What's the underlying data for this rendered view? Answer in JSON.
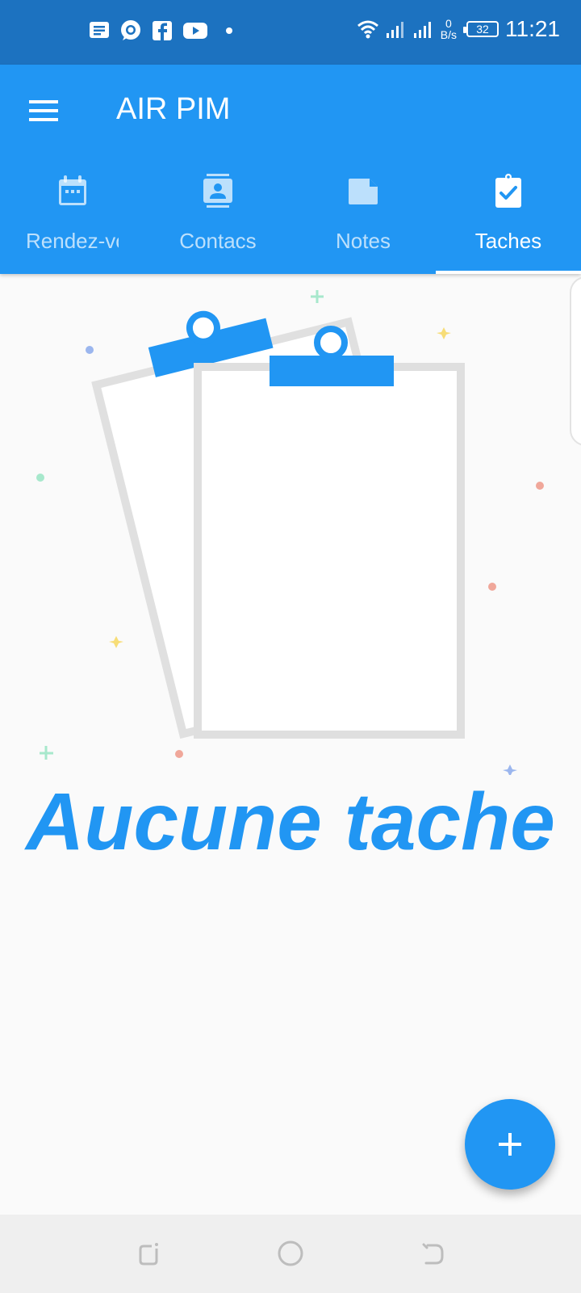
{
  "status_bar": {
    "time": "11:21",
    "net_speed_value": "0",
    "net_speed_unit": "B/s",
    "battery": "32",
    "notification_icons": [
      "message-icon",
      "whatsapp-icon",
      "facebook-icon",
      "youtube-icon",
      "dot-icon"
    ],
    "system_icons": [
      "wifi-icon",
      "signal-icon",
      "signal-icon",
      "battery-icon"
    ]
  },
  "app_bar": {
    "title": "AIR PIM"
  },
  "tabs": [
    {
      "label": "Rendez-vous",
      "icon": "calendar-icon",
      "active": false
    },
    {
      "label": "Contacs",
      "icon": "contact-card-icon",
      "active": false
    },
    {
      "label": "Notes",
      "icon": "note-icon",
      "active": false
    },
    {
      "label": "Taches",
      "icon": "clipboard-check-icon",
      "active": true
    }
  ],
  "empty_state": {
    "message": "Aucune tache",
    "illustration": "clipboard-illustration"
  },
  "fab": {
    "icon": "plus-icon"
  },
  "nav_bar": {
    "icons": [
      "recents-icon",
      "home-icon",
      "back-icon"
    ]
  },
  "colors": {
    "status_bar": "#1c72c0",
    "primary": "#2196f3",
    "background": "#fafafa"
  }
}
